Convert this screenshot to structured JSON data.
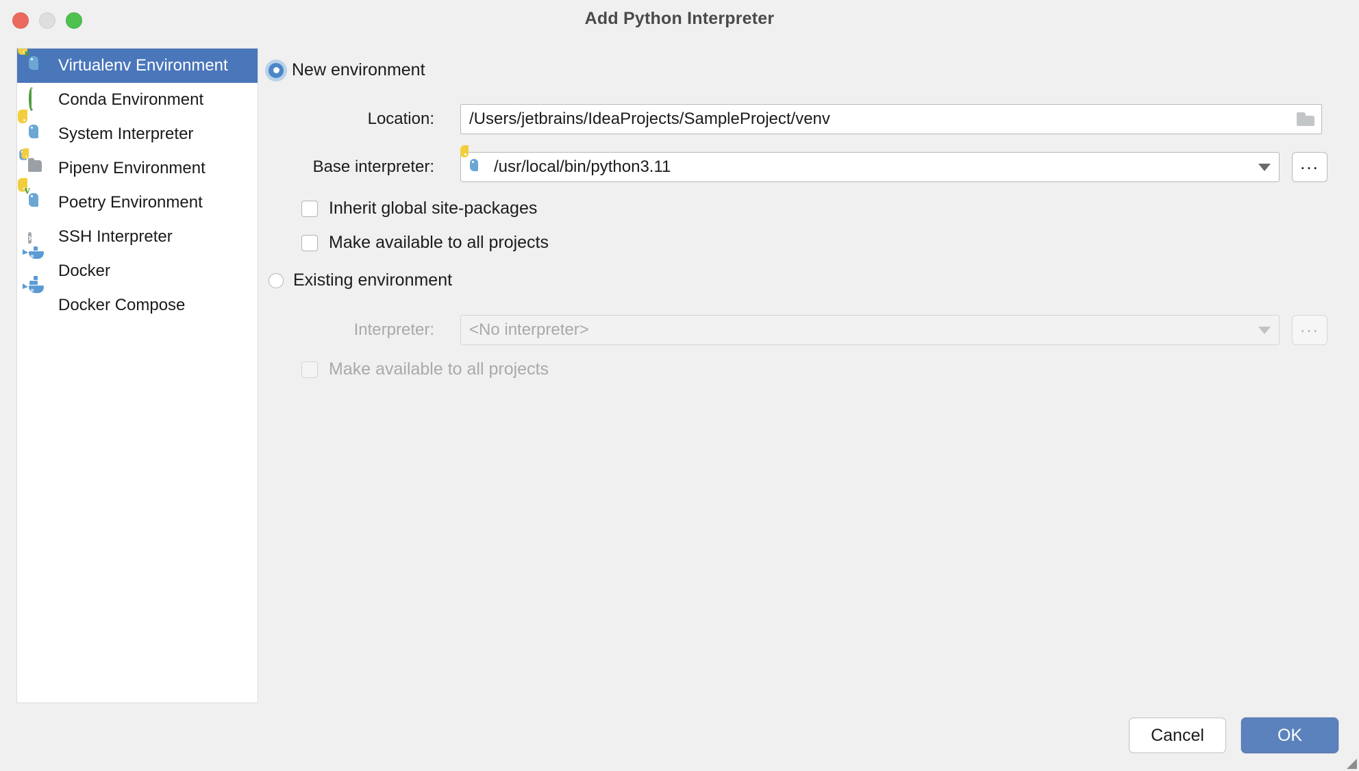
{
  "window": {
    "title": "Add Python Interpreter",
    "traffic_lights": [
      "close-red",
      "minimize-yellow",
      "maximize-green"
    ]
  },
  "sidebar": {
    "items": [
      {
        "label": "Virtualenv Environment",
        "icon": "python-venv-icon",
        "selected": true
      },
      {
        "label": "Conda Environment",
        "icon": "conda-ring-icon",
        "selected": false
      },
      {
        "label": "System Interpreter",
        "icon": "python-icon",
        "selected": false
      },
      {
        "label": "Pipenv Environment",
        "icon": "folder-python-icon",
        "selected": false
      },
      {
        "label": "Poetry Environment",
        "icon": "python-venv-icon",
        "selected": false
      },
      {
        "label": "SSH Interpreter",
        "icon": "ssh-terminal-icon",
        "selected": false
      },
      {
        "label": "Docker",
        "icon": "docker-whale-icon",
        "selected": false
      },
      {
        "label": "Docker Compose",
        "icon": "docker-compose-whale-icon",
        "selected": false
      }
    ]
  },
  "main": {
    "new_environment": {
      "radio_label": "New environment",
      "selected": true,
      "location": {
        "label": "Location:",
        "value": "/Users/jetbrains/IdeaProjects/SampleProject/venv",
        "browse_icon": "folder-icon"
      },
      "base_interpreter": {
        "label": "Base interpreter:",
        "value": "/usr/local/bin/python3.11",
        "value_icon": "python-icon",
        "dropdown_icon": "chevron-down-icon",
        "browse_label": "..."
      },
      "checkboxes": [
        {
          "label": "Inherit global site-packages",
          "checked": false
        },
        {
          "label": "Make available to all projects",
          "checked": false
        }
      ]
    },
    "existing_environment": {
      "radio_label": "Existing environment",
      "selected": false,
      "interpreter": {
        "label": "Interpreter:",
        "value": "<No interpreter>",
        "dropdown_icon": "chevron-down-icon",
        "browse_label": "...",
        "disabled": true
      },
      "checkboxes": [
        {
          "label": "Make available to all projects",
          "checked": false,
          "disabled": true
        }
      ]
    }
  },
  "footer": {
    "cancel_label": "Cancel",
    "ok_label": "OK"
  },
  "colors": {
    "selection_blue": "#4a76ba",
    "primary_button": "#5b82bd",
    "radio_accent": "#4a86c8",
    "window_bg": "#f0f0f0",
    "panel_bg": "#ffffff",
    "disabled_text": "#a9a9a9"
  }
}
